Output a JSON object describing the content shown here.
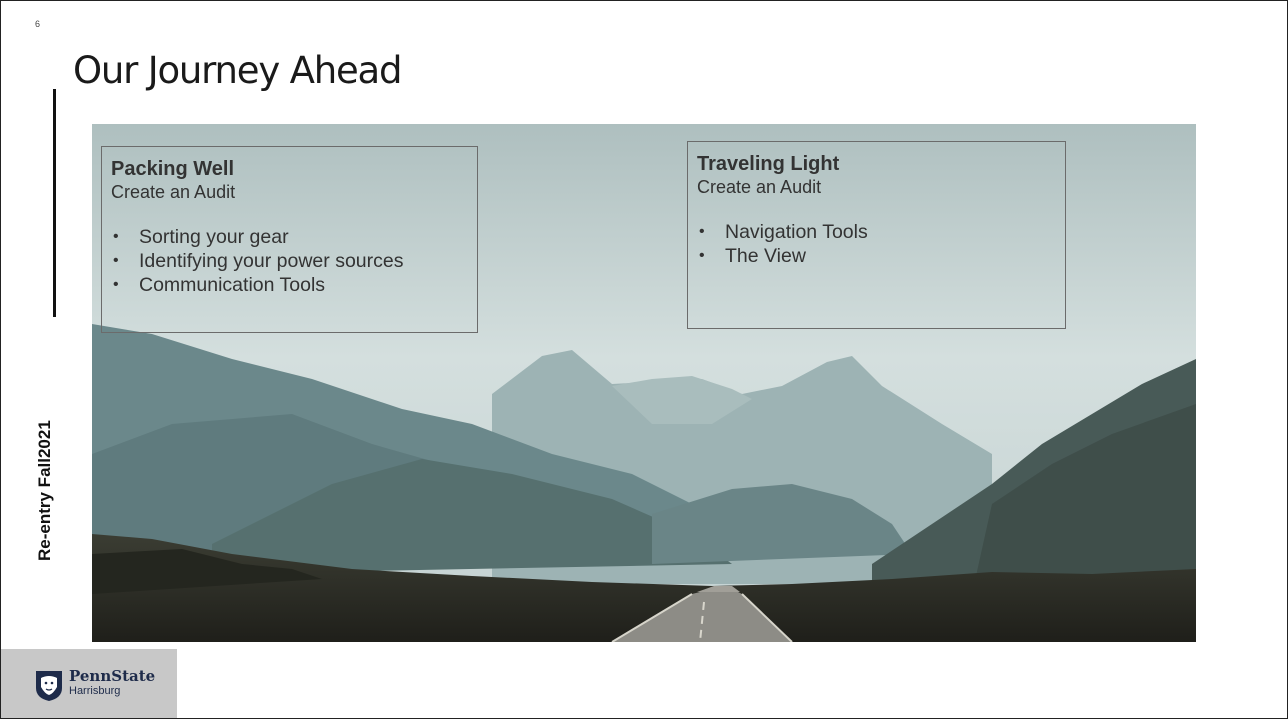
{
  "slide": {
    "number": "6",
    "title": "Our Journey Ahead",
    "side_label": "Re-entry Fall2021"
  },
  "left_box": {
    "heading": "Packing Well",
    "subheading": "Create an Audit",
    "items": [
      "Sorting your gear",
      "Identifying your power sources",
      "Communication Tools"
    ]
  },
  "right_box": {
    "heading": "Traveling Light",
    "subheading": "Create an Audit",
    "items": [
      "Navigation Tools",
      "The View"
    ]
  },
  "logo": {
    "name": "PennState",
    "campus": "Harrisburg",
    "icon": "nittany-lion-shield-icon"
  },
  "photo": {
    "subject": "road-through-misty-mountains",
    "colors": {
      "sky": "#c9d7d6",
      "mountain_far": "#8fa9ab",
      "mountain_mid": "#6d8b8f",
      "mountain_near": "#3e5457",
      "ground": "#2a2a22",
      "road": "#8a8a84"
    }
  }
}
